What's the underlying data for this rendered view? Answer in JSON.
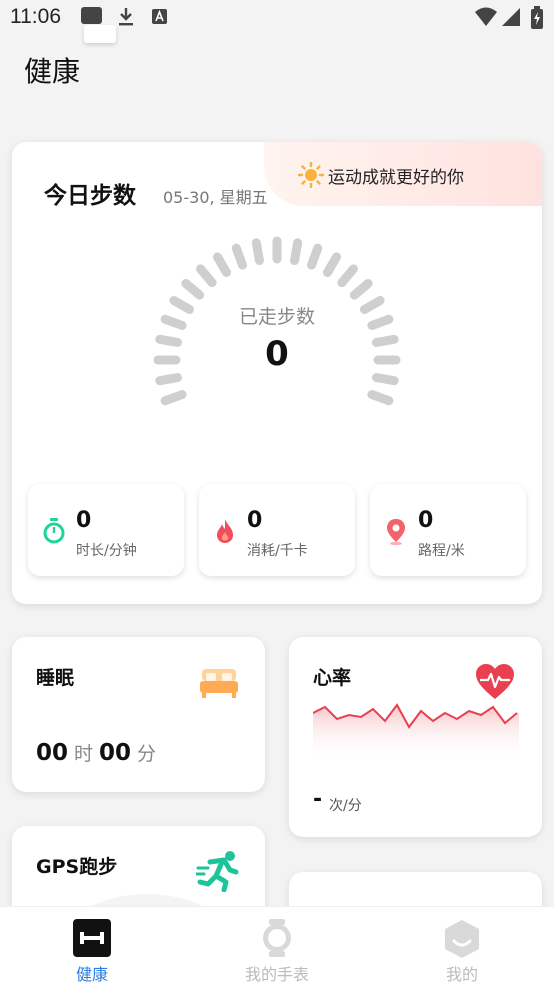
{
  "status_bar": {
    "time": "11:06"
  },
  "page": {
    "title": "健康"
  },
  "steps": {
    "title": "今日步数",
    "date": "05-30, 星期五",
    "banner": "运动成就更好的你",
    "gauge_label": "已走步数",
    "value": "0",
    "metrics": [
      {
        "value": "0",
        "label": "时长/分钟",
        "icon": "timer-icon"
      },
      {
        "value": "0",
        "label": "消耗/千卡",
        "icon": "flame-icon"
      },
      {
        "value": "0",
        "label": "路程/米",
        "icon": "location-pin-icon"
      }
    ]
  },
  "sleep": {
    "title": "睡眠",
    "hours": "00",
    "hour_unit": "时",
    "minutes": "00",
    "minute_unit": "分"
  },
  "heart": {
    "title": "心率",
    "value": "-",
    "unit": "次/分"
  },
  "gps": {
    "title": "GPS跑步"
  },
  "nav": [
    {
      "label": "健康",
      "active": true
    },
    {
      "label": "我的手表",
      "active": false
    },
    {
      "label": "我的",
      "active": false
    }
  ],
  "colors": {
    "accent": "#2a7de1",
    "heart": "#e8404f",
    "timer": "#1dd59a",
    "flame": "#f04e5c"
  }
}
